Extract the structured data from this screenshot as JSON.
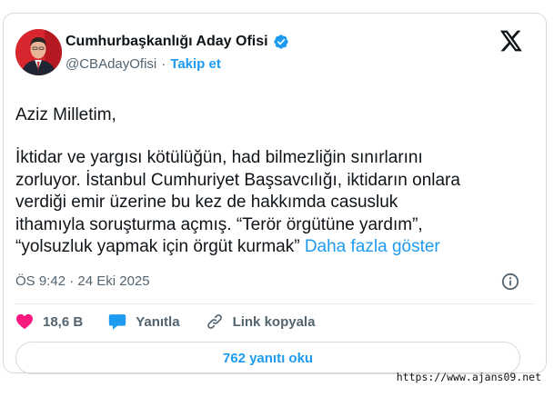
{
  "author": {
    "display_name": "Cumhurbaşkanlığı Aday Ofisi",
    "handle": "@CBAdayOfisi",
    "separator": "·",
    "follow_label": "Takip et",
    "avatar_icon": "profile-photo-icon",
    "verified_icon": "verified-badge-icon"
  },
  "brand": {
    "logo_icon": "x-logo-icon"
  },
  "post": {
    "greeting": "Aziz Milletim,",
    "lines": [
      "İktidar ve yargısı kötülüğün, had bilmezliğin sınırlarını",
      "zorluyor. İstanbul Cumhuriyet Başsavcılığı, iktidarın onlara",
      "verdiği emir üzerine bu kez de hakkımda casusluk",
      "ithamıyla soruşturma açmış. “Terör örgütüne yardım”,",
      "“yolsuzluk yapmak için örgüt kurmak”"
    ],
    "show_more_label": "Daha fazla göster",
    "timestamp": "ÖS 9:42 · 24 Eki 2025",
    "info_icon": "info-icon"
  },
  "actions": {
    "like_count": "18,6 B",
    "reply_label": "Yanıtla",
    "copy_link_label": "Link kopyala",
    "read_replies_label": "762 yanıtı oku"
  },
  "watermark": "https://www.ajans09.net",
  "colors": {
    "accent": "#1d9bf0",
    "like": "#f91880",
    "text": "#0f1419",
    "muted": "#536471",
    "border": "#d6dadd"
  }
}
